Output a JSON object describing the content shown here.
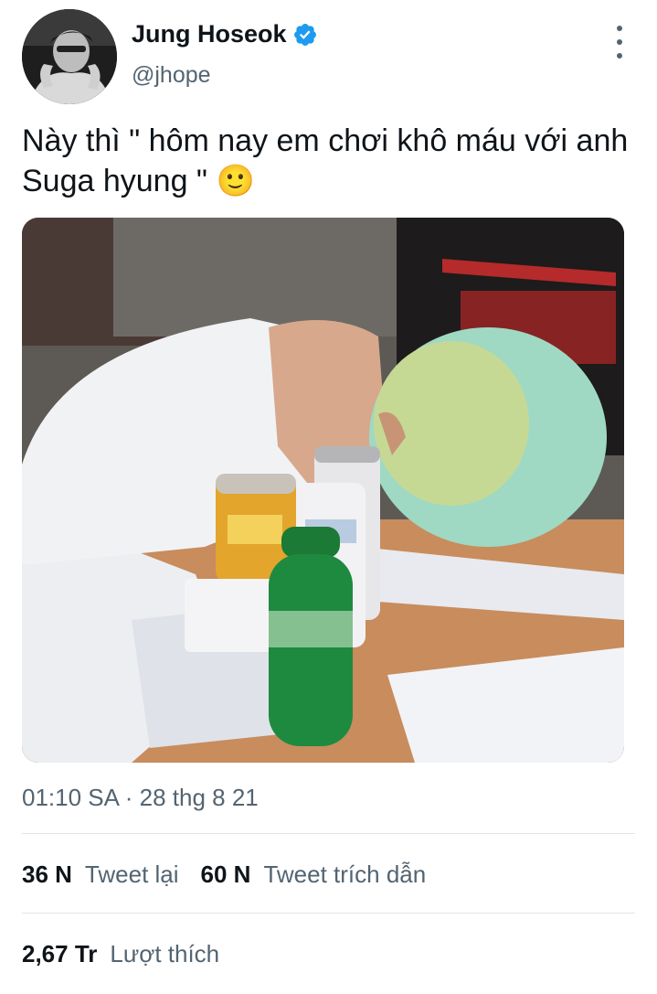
{
  "author": {
    "display_name": "Jung Hoseok",
    "handle": "@jhope",
    "verified": true,
    "verified_color": "#1d9bf0"
  },
  "tweet": {
    "text": "Này thì \" hôm nay em chơi khô máu với anh Suga hyung \" 🙂",
    "timestamp": "01:10 SA · 28 thg 8 21"
  },
  "stats": {
    "retweets_count": "36 N",
    "retweets_label": "Tweet lại",
    "quotes_count": "60 N",
    "quotes_label": "Tweet trích dẫn",
    "likes_count": "2,67 Tr",
    "likes_label": "Lượt thích"
  },
  "icons": {
    "verified": "verified-badge-icon",
    "more": "more-vertical-icon"
  },
  "colors": {
    "text_primary": "#0f1419",
    "text_secondary": "#536471",
    "divider": "#e1e4e8"
  }
}
